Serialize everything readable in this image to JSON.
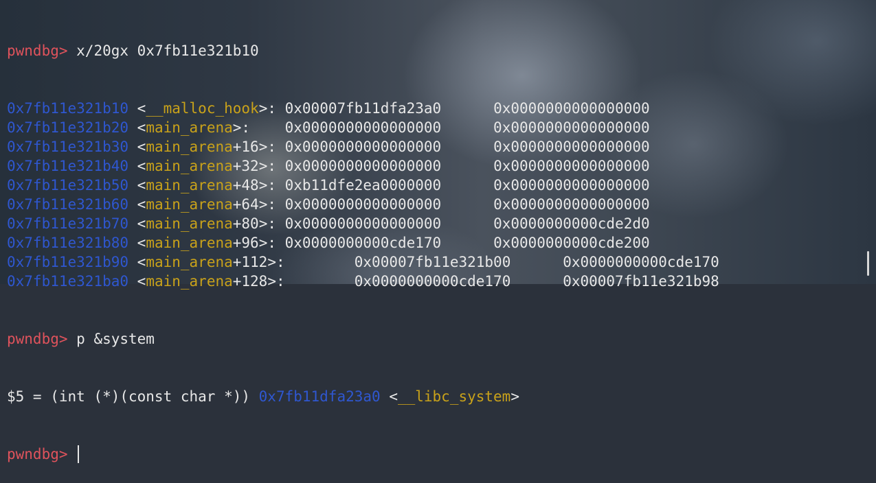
{
  "terminal": {
    "prompt": "pwndbg>",
    "command1": " x/20gx 0x7fb11e321b10",
    "rows": [
      {
        "addr": "0x7fb11e321b10",
        "symbol": "__malloc_hook",
        "sep": ">: ",
        "v1": "0x00007fb11dfa23a0",
        "gap": "      ",
        "v2": "0x0000000000000000"
      },
      {
        "addr": "0x7fb11e321b20",
        "symbol": "main_arena",
        "sep": ">:    ",
        "v1": "0x0000000000000000",
        "gap": "      ",
        "v2": "0x0000000000000000"
      },
      {
        "addr": "0x7fb11e321b30",
        "symbol": "main_arena",
        "offset": "+16",
        "sep": ">: ",
        "v1": "0x0000000000000000",
        "gap": "      ",
        "v2": "0x0000000000000000"
      },
      {
        "addr": "0x7fb11e321b40",
        "symbol": "main_arena",
        "offset": "+32",
        "sep": ">: ",
        "v1": "0x0000000000000000",
        "gap": "      ",
        "v2": "0x0000000000000000"
      },
      {
        "addr": "0x7fb11e321b50",
        "symbol": "main_arena",
        "offset": "+48",
        "sep": ">: ",
        "v1": "0xb11dfe2ea0000000",
        "gap": "      ",
        "v2": "0x0000000000000000"
      },
      {
        "addr": "0x7fb11e321b60",
        "symbol": "main_arena",
        "offset": "+64",
        "sep": ">: ",
        "v1": "0x0000000000000000",
        "gap": "      ",
        "v2": "0x0000000000000000"
      },
      {
        "addr": "0x7fb11e321b70",
        "symbol": "main_arena",
        "offset": "+80",
        "sep": ">: ",
        "v1": "0x0000000000000000",
        "gap": "      ",
        "v2": "0x0000000000cde2d0"
      },
      {
        "addr": "0x7fb11e321b80",
        "symbol": "main_arena",
        "offset": "+96",
        "sep": ">: ",
        "v1": "0x0000000000cde170",
        "gap": "      ",
        "v2": "0x0000000000cde200"
      },
      {
        "addr": "0x7fb11e321b90",
        "symbol": "main_arena",
        "offset": "+112",
        "sep": ">:        ",
        "v1": "0x00007fb11e321b00",
        "gap": "      ",
        "v2": "0x0000000000cde170"
      },
      {
        "addr": "0x7fb11e321ba0",
        "symbol": "main_arena",
        "offset": "+128",
        "sep": ">:        ",
        "v1": "0x0000000000cde170",
        "gap": "      ",
        "v2": "0x00007fb11e321b98"
      }
    ],
    "command2": " p &system",
    "result": {
      "prefix": "$5 = (int (*)(const char *)) ",
      "addr": "0x7fb11dfa23a0",
      "lt": " <",
      "symbol": "__libc_system",
      "gt": ">"
    },
    "final_prompt": "pwndbg>",
    "final_space": " "
  },
  "colors": {
    "prompt": "#e0535c",
    "address": "#2f57d0",
    "symbol": "#c9a21a",
    "text": "#e8e8e8"
  }
}
